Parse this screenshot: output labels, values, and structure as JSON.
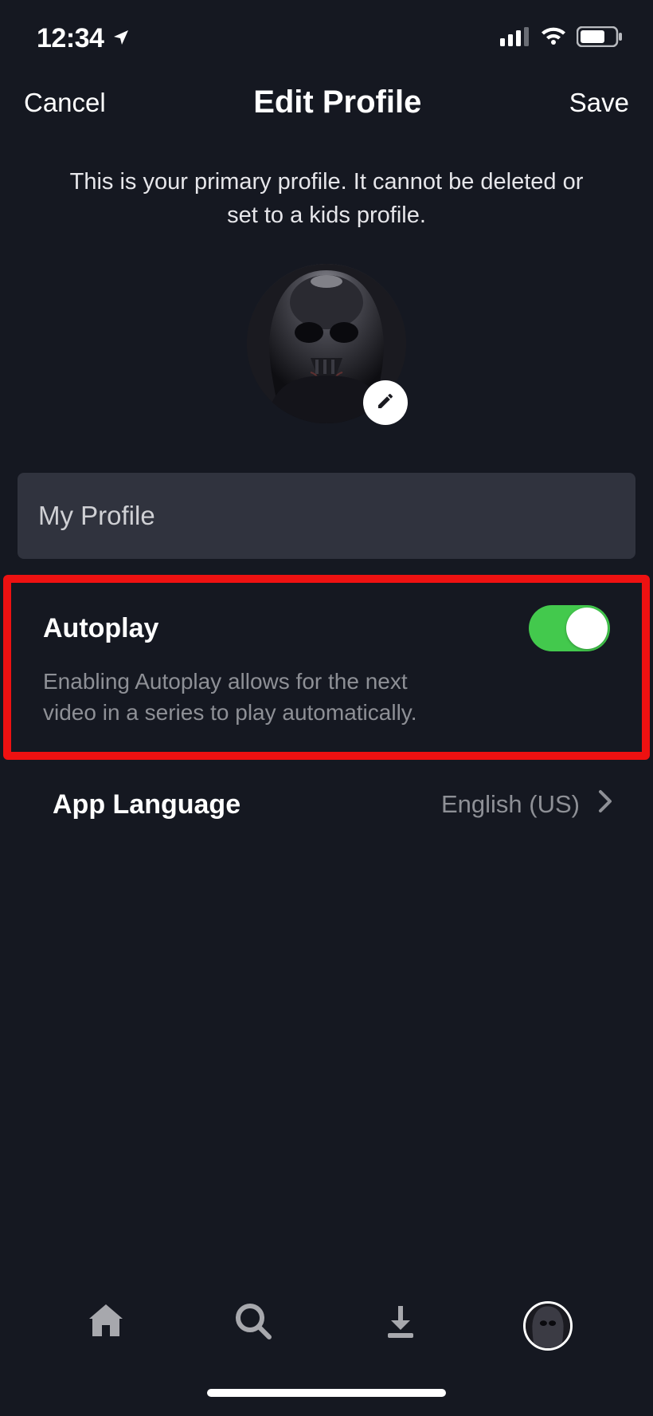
{
  "status": {
    "time": "12:34",
    "location_icon": "location-arrow"
  },
  "header": {
    "cancel": "Cancel",
    "title": "Edit Profile",
    "save": "Save"
  },
  "info_text": "This is your primary profile. It cannot be deleted or set to a kids profile.",
  "profile_name": "My Profile",
  "autoplay": {
    "title": "Autoplay",
    "description": "Enabling Autoplay allows for the next video in a series to play automatically.",
    "enabled": true
  },
  "language": {
    "title": "App Language",
    "value": "English (US)"
  },
  "highlight": {
    "target": "autoplay",
    "color": "#ee1111"
  },
  "colors": {
    "background": "#151821",
    "input_bg": "#30333e",
    "toggle_on": "#43c94d",
    "secondary_text": "#8e9096"
  }
}
